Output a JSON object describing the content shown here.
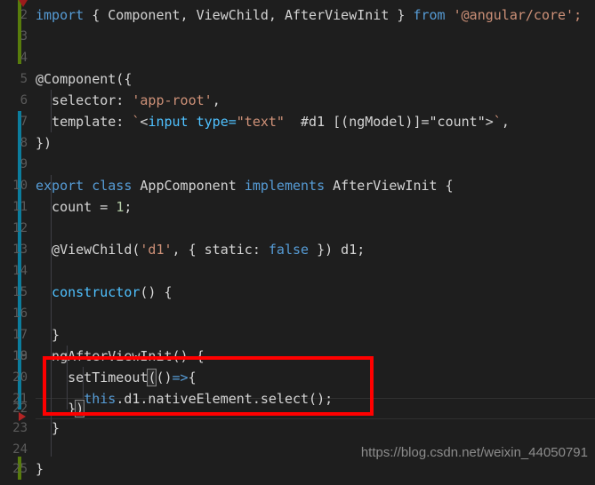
{
  "editor": {
    "theme": "dark",
    "background": "#1e1e1e",
    "gutter_color": "#5a5a5a",
    "first_visible_line": 2,
    "last_visible_line": 25,
    "active_line": 22,
    "colors": {
      "keyword": "#569cd6",
      "string": "#ce9178",
      "function": "#4fc1ff",
      "text": "#d4d4d4",
      "number": "#b5cea8",
      "change_added": "#587c0c",
      "change_modified": "#0c7d9d",
      "annotation": "#ff0000"
    }
  },
  "line_numbers": [
    "2",
    "3",
    "4",
    "5",
    "6",
    "7",
    "8",
    "9",
    "10",
    "11",
    "12",
    "13",
    "14",
    "15",
    "16",
    "17",
    "18",
    "19",
    "20",
    "21",
    "22",
    "23",
    "24",
    "25"
  ],
  "lines": [
    {
      "n": "2",
      "text": "import { Component, ViewChild, AfterViewInit } from '@angular/core';"
    },
    {
      "n": "3",
      "text": ""
    },
    {
      "n": "4",
      "text": ""
    },
    {
      "n": "5",
      "text": "@Component({"
    },
    {
      "n": "6",
      "text": "  selector: 'app-root',"
    },
    {
      "n": "7",
      "text": "  template: `<input type=\"text\"  #d1 [(ngModel)]=\"count\">`,"
    },
    {
      "n": "8",
      "text": "})"
    },
    {
      "n": "9",
      "text": ""
    },
    {
      "n": "10",
      "text": "export class AppComponent implements AfterViewInit {"
    },
    {
      "n": "11",
      "text": "  count = 1;"
    },
    {
      "n": "12",
      "text": ""
    },
    {
      "n": "13",
      "text": "  @ViewChild('d1', { static: false }) d1;"
    },
    {
      "n": "14",
      "text": ""
    },
    {
      "n": "15",
      "text": "  constructor() {"
    },
    {
      "n": "16",
      "text": ""
    },
    {
      "n": "17",
      "text": "  }"
    },
    {
      "n": "18",
      "text": ""
    },
    {
      "n": "19",
      "text": "  ngAfterViewInit() {"
    },
    {
      "n": "20",
      "text": "    setTimeout(()=>{"
    },
    {
      "n": "21",
      "text": "      this.d1.nativeElement.select();"
    },
    {
      "n": "22",
      "text": "    })"
    },
    {
      "n": "23",
      "text": "  }"
    },
    {
      "n": "24",
      "text": ""
    },
    {
      "n": "25",
      "text": "}"
    }
  ],
  "tokens": {
    "l2": {
      "import": "import",
      "brace_open": " { ",
      "component": "Component,",
      "viewchild": " ViewChild,",
      "afterviewinit": " AfterViewInit",
      "brace_close": " } ",
      "from": "from",
      "module": " '@angular/core';"
    },
    "l5": {
      "decorator": "@Component({"
    },
    "l6": {
      "key": "  selector: ",
      "value": "'app-root'",
      "comma": ","
    },
    "l7": {
      "key": "  template: ",
      "tick_open": "`",
      "lt": "<",
      "input": "input",
      "type_attr": " type=",
      "type_val": "\"text\"",
      "ref": "  #d1 [(ngModel)]=",
      "count_val": "\"count\"",
      "gt": ">",
      "tick_close": "`",
      "comma": ","
    },
    "l8": {
      "text": "})"
    },
    "l10": {
      "export": "export",
      "class": " class",
      "name": " AppComponent ",
      "implements": "implements",
      "iface": " AfterViewInit {"
    },
    "l11": {
      "name": "  count = ",
      "value": "1",
      "semi": ";"
    },
    "l13": {
      "decorator": "  @ViewChild(",
      "ref": "'d1'",
      "mid": ", { static: ",
      "bool": "false",
      "tail": " }) d1;"
    },
    "l15": {
      "name": "  constructor",
      "tail": "() {"
    },
    "l17": {
      "text": "  }"
    },
    "l19": {
      "name": "  ngAfterViewInit",
      "tail": "() {"
    },
    "l20": {
      "indent": "    ",
      "name": "setTimeout",
      "bracket": "(",
      "paren": "()",
      "arrow": "=>",
      "brace": "{"
    },
    "l21": {
      "indent": "      ",
      "this": "this",
      "chain": ".d1.nativeElement.select();"
    },
    "l22": {
      "indent": "    ",
      "brace": "}",
      "bracket": ")"
    },
    "l23": {
      "text": "  }"
    },
    "l25": {
      "text": "}"
    }
  },
  "annotation": {
    "shape": "rectangle",
    "color": "#ff0000",
    "covers_lines": [
      "20",
      "21",
      "22"
    ],
    "label": "highlighted-setTimeout-block"
  },
  "watermark": {
    "text": "https://blog.csdn.net/weixin_44050791"
  },
  "gutter_markers": {
    "change_bars": [
      {
        "type": "added",
        "color": "#587c0c",
        "from_line": "2",
        "to_line": "4"
      },
      {
        "type": "modified",
        "color": "#0c7d9d",
        "from_line": "7",
        "to_line": "21"
      },
      {
        "type": "added",
        "color": "#587c0c",
        "from_line": "25",
        "to_line": "25"
      }
    ],
    "triangles": [
      {
        "name": "fold-marker-top",
        "direction": "down",
        "line": "2"
      },
      {
        "name": "fold-marker-bottom",
        "direction": "right",
        "line": "22"
      }
    ]
  }
}
